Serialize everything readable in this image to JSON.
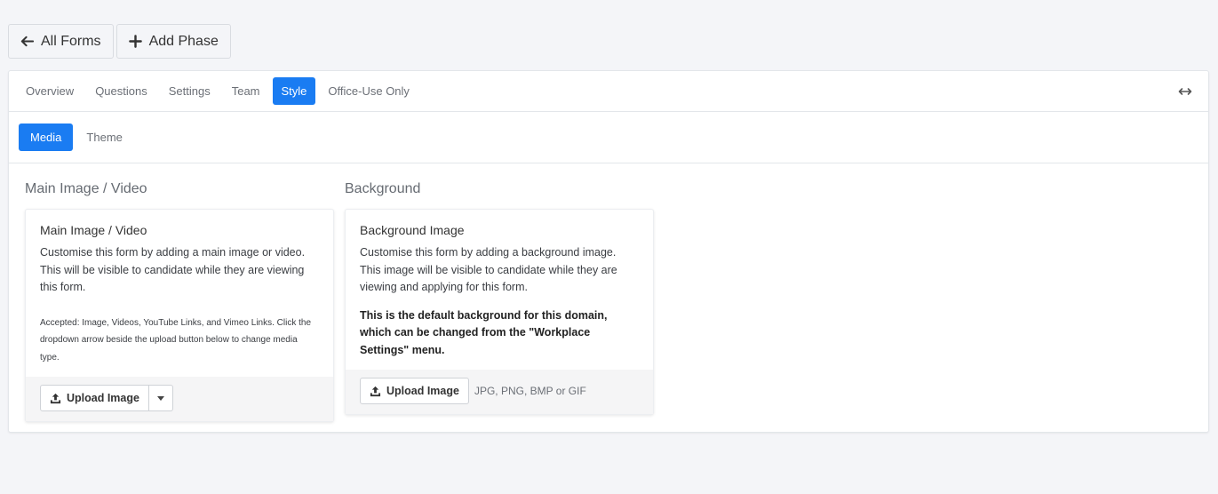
{
  "topbar": {
    "back_label": "All Forms",
    "add_phase_label": "Add Phase"
  },
  "tabs": [
    {
      "label": "Overview",
      "active": false
    },
    {
      "label": "Questions",
      "active": false
    },
    {
      "label": "Settings",
      "active": false
    },
    {
      "label": "Team",
      "active": false
    },
    {
      "label": "Style",
      "active": true
    },
    {
      "label": "Office-Use Only",
      "active": false
    }
  ],
  "subtabs": [
    {
      "label": "Media",
      "active": true
    },
    {
      "label": "Theme",
      "active": false
    }
  ],
  "main_media": {
    "section_title": "Main Image / Video",
    "card_title": "Main Image / Video",
    "description": "Customise this form by adding a main image or video. This will be visible to candidate while they are viewing this form.",
    "accepted_note": "Accepted: Image, Videos, YouTube Links, and Vimeo Links. Click the dropdown arrow beside the upload button below to change media type.",
    "upload_label": "Upload Image"
  },
  "background": {
    "section_title": "Background",
    "card_title": "Background Image",
    "description": "Customise this form by adding a background image. This image will be visible to candidate while they are viewing and applying for this form.",
    "default_note": "This is the default background for this domain, which can be changed from the \"Workplace Settings\" menu.",
    "upload_label": "Upload Image",
    "formats_hint": "JPG, PNG, BMP or GIF"
  },
  "colors": {
    "accent": "#1a7cf2",
    "page_bg": "#f4f5f8"
  }
}
